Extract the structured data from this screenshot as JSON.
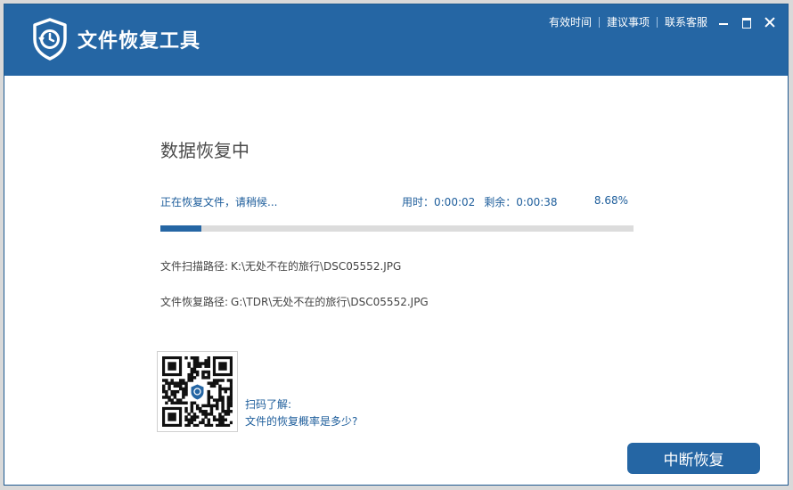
{
  "app": {
    "title": "文件恢复工具"
  },
  "header": {
    "links": [
      "有效时间",
      "建议事项",
      "联系客服"
    ],
    "icons": [
      "minimize-icon",
      "maximize-icon",
      "close-icon"
    ]
  },
  "main": {
    "heading": "数据恢复中",
    "status": "正在恢复文件，请稍候...",
    "elapsed": "用时：0:00:02",
    "remaining": "剩余：0:00:38",
    "percent_text": "8.68%",
    "progress_fraction": 0.0868,
    "scan_path_label": "文件扫描路径:",
    "scan_path": "K:\\无处不在的旅行\\DSC05552.JPG",
    "restore_path_label": "文件恢复路径:",
    "restore_path": "G:\\TDR\\无处不在的旅行\\DSC05552.JPG"
  },
  "qr": {
    "line1": "扫码了解:",
    "line2": "文件的恢复概率是多少?"
  },
  "actions": {
    "stop_label": "中断恢复"
  },
  "colors": {
    "brand": "#2566a4",
    "link": "#1d5d9b"
  }
}
